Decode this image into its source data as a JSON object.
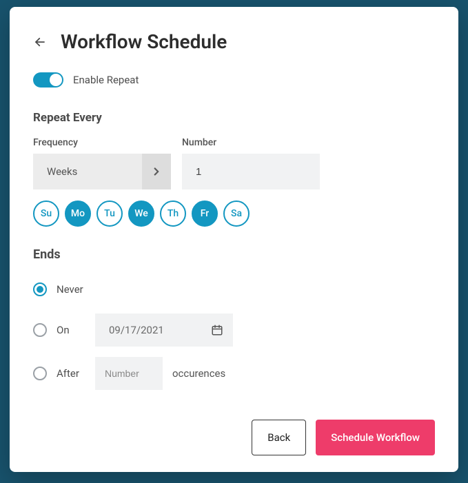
{
  "header": {
    "title": "Workflow Schedule"
  },
  "toggle": {
    "label": "Enable Repeat",
    "on": true
  },
  "repeat": {
    "heading": "Repeat Every",
    "frequency_label": "Frequency",
    "frequency_value": "Weeks",
    "number_label": "Number",
    "number_value": "1",
    "days": [
      {
        "abbr": "Su",
        "selected": false
      },
      {
        "abbr": "Mo",
        "selected": true
      },
      {
        "abbr": "Tu",
        "selected": false
      },
      {
        "abbr": "We",
        "selected": true
      },
      {
        "abbr": "Th",
        "selected": false
      },
      {
        "abbr": "Fr",
        "selected": true
      },
      {
        "abbr": "Sa",
        "selected": false
      }
    ]
  },
  "ends": {
    "heading": "Ends",
    "never_label": "Never",
    "on_label": "On",
    "on_date": "09/17/2021",
    "after_label": "After",
    "after_placeholder": "Number",
    "occurrences_label": "occurences",
    "selected": "never"
  },
  "footer": {
    "back_label": "Back",
    "submit_label": "Schedule Workflow"
  },
  "colors": {
    "accent": "#1397c1",
    "primary_action": "#ee3c6a"
  }
}
